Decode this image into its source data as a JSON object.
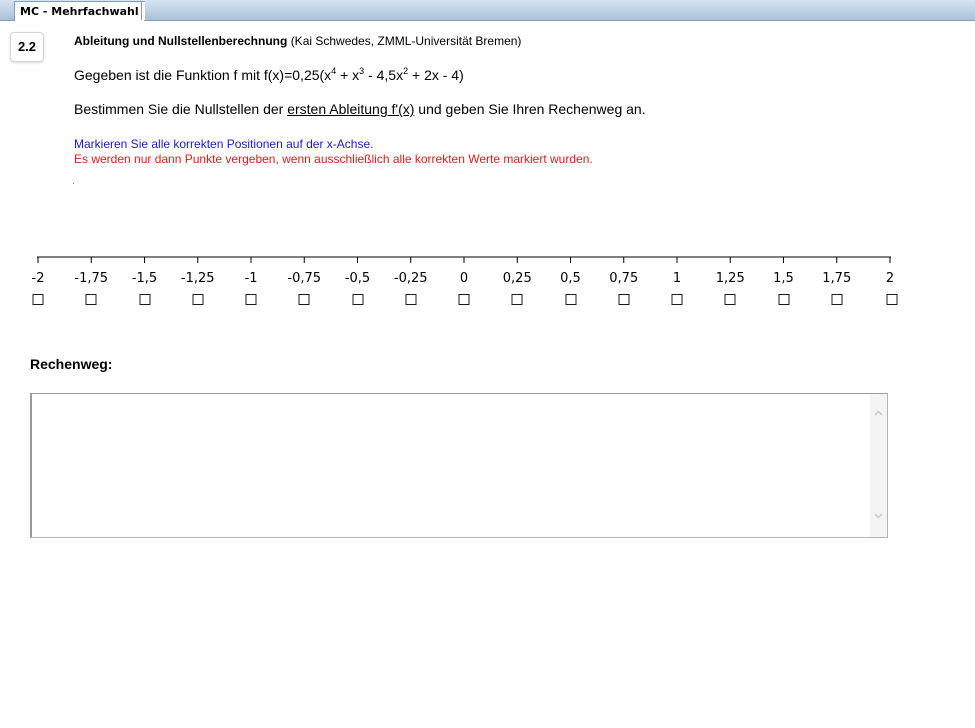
{
  "tab": {
    "label": "MC - Mehrfachwahl"
  },
  "question": {
    "number": "2.2",
    "title": "Ableitung und Nullstellenberechnung",
    "author": "(Kai Schwedes, ZMML-Universität Bremen)",
    "function_prefix": "Gegeben ist die Funktion f mit f(x)=0,25(x",
    "exp1": "4",
    "plus1": " + x",
    "exp2": "3",
    "minus": " - 4,5x",
    "exp3": "2",
    "function_rest": " + 2x - 4)",
    "task_prefix": "Bestimmen Sie die Nullstellen der ",
    "task_underlined": "ersten Ableitung f'(x)",
    "task_suffix": " und geben Sie Ihren Rechenweg an.",
    "hint_blue": "Markieren Sie alle korrekten Positionen auf der x-Achse.",
    "hint_red": "Es werden nur dann Punkte vergeben, wenn ausschließlich alle korrekten Werte markiert wurden."
  },
  "axis": {
    "labels": [
      "-2",
      "-1,75",
      "-1,5",
      "-1,25",
      "-1",
      "-0,75",
      "-0,5",
      "-0,25",
      "0",
      "0,25",
      "0,5",
      "0,75",
      "1",
      "1,25",
      "1,5",
      "1,75",
      "2"
    ]
  },
  "rechenweg": {
    "label": "Rechenweg:",
    "value": ""
  },
  "colors": {
    "hint_blue": "#1a1acc",
    "hint_red": "#e21b1b"
  }
}
